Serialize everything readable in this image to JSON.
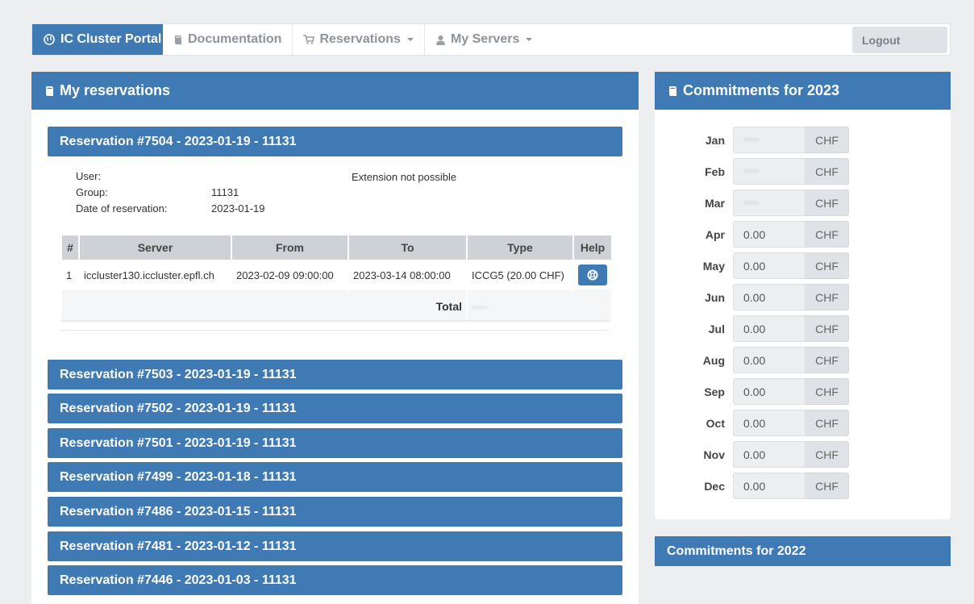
{
  "nav": {
    "brand": "IC Cluster Portal",
    "documentation": "Documentation",
    "reservations": "Reservations",
    "my_servers": "My Servers",
    "logout": "Logout"
  },
  "my_reservations": {
    "title": "My reservations",
    "open": {
      "header": "Reservation #7504 - 2023-01-19 - 11131",
      "user_label": "User:",
      "user_value": "",
      "group_label": "Group:",
      "group_value": "11131",
      "date_label": "Date of reservation:",
      "date_value": "2023-01-19",
      "extension": "Extension not possible",
      "table": {
        "headers": [
          "#",
          "Server",
          "From",
          "To",
          "Type",
          "Help"
        ],
        "rows": [
          [
            "1",
            "iccluster130.iccluster.epfl.ch",
            "2023-02-09 09:00:00",
            "2023-03-14 08:00:00",
            "ICCG5 (20.00 CHF)"
          ]
        ],
        "total_label": "Total"
      }
    },
    "collapsed": [
      "Reservation #7503 - 2023-01-19 - 11131",
      "Reservation #7502 - 2023-01-19 - 11131",
      "Reservation #7501 - 2023-01-19 - 11131",
      "Reservation #7499 - 2023-01-18 - 11131",
      "Reservation #7486 - 2023-01-15 - 11131",
      "Reservation #7481 - 2023-01-12 - 11131",
      "Reservation #7446 - 2023-01-03 - 11131"
    ]
  },
  "commitments_2023": {
    "title": "Commitments for 2023",
    "currency": "CHF",
    "months": [
      {
        "label": "Jan",
        "value": ""
      },
      {
        "label": "Feb",
        "value": ""
      },
      {
        "label": "Mar",
        "value": ""
      },
      {
        "label": "Apr",
        "value": "0.00"
      },
      {
        "label": "May",
        "value": "0.00"
      },
      {
        "label": "Jun",
        "value": "0.00"
      },
      {
        "label": "Jul",
        "value": "0.00"
      },
      {
        "label": "Aug",
        "value": "0.00"
      },
      {
        "label": "Sep",
        "value": "0.00"
      },
      {
        "label": "Oct",
        "value": "0.00"
      },
      {
        "label": "Nov",
        "value": "0.00"
      },
      {
        "label": "Dec",
        "value": "0.00"
      }
    ]
  },
  "commitments_2022": {
    "title": "Commitments for 2022"
  },
  "colors": {
    "primary": "#3f7ab5",
    "background": "#edeef0"
  }
}
